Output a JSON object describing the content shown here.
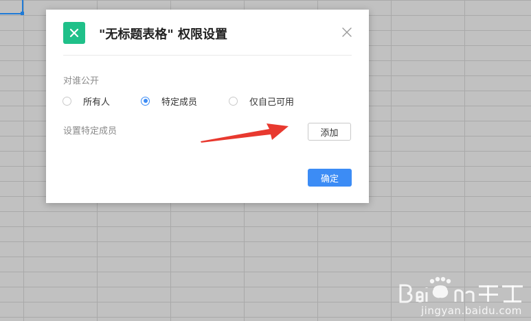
{
  "dialog": {
    "title": "\"无标题表格\" 权限设置",
    "close_icon": "close-icon",
    "app_icon": "spreadsheet-x-icon",
    "app_icon_color": "#1fc089"
  },
  "visibility": {
    "label": "对谁公开",
    "options": [
      {
        "label": "所有人",
        "checked": false
      },
      {
        "label": "特定成员",
        "checked": true
      },
      {
        "label": "仅自己可用",
        "checked": false
      }
    ]
  },
  "members": {
    "label": "设置特定成员",
    "add_label": "添加"
  },
  "footer": {
    "confirm_label": "确定",
    "confirm_color": "#3c8cf5"
  },
  "annotation": {
    "arrow_color": "#e8392f"
  },
  "watermark": {
    "url": "jingyan.baidu.com"
  }
}
